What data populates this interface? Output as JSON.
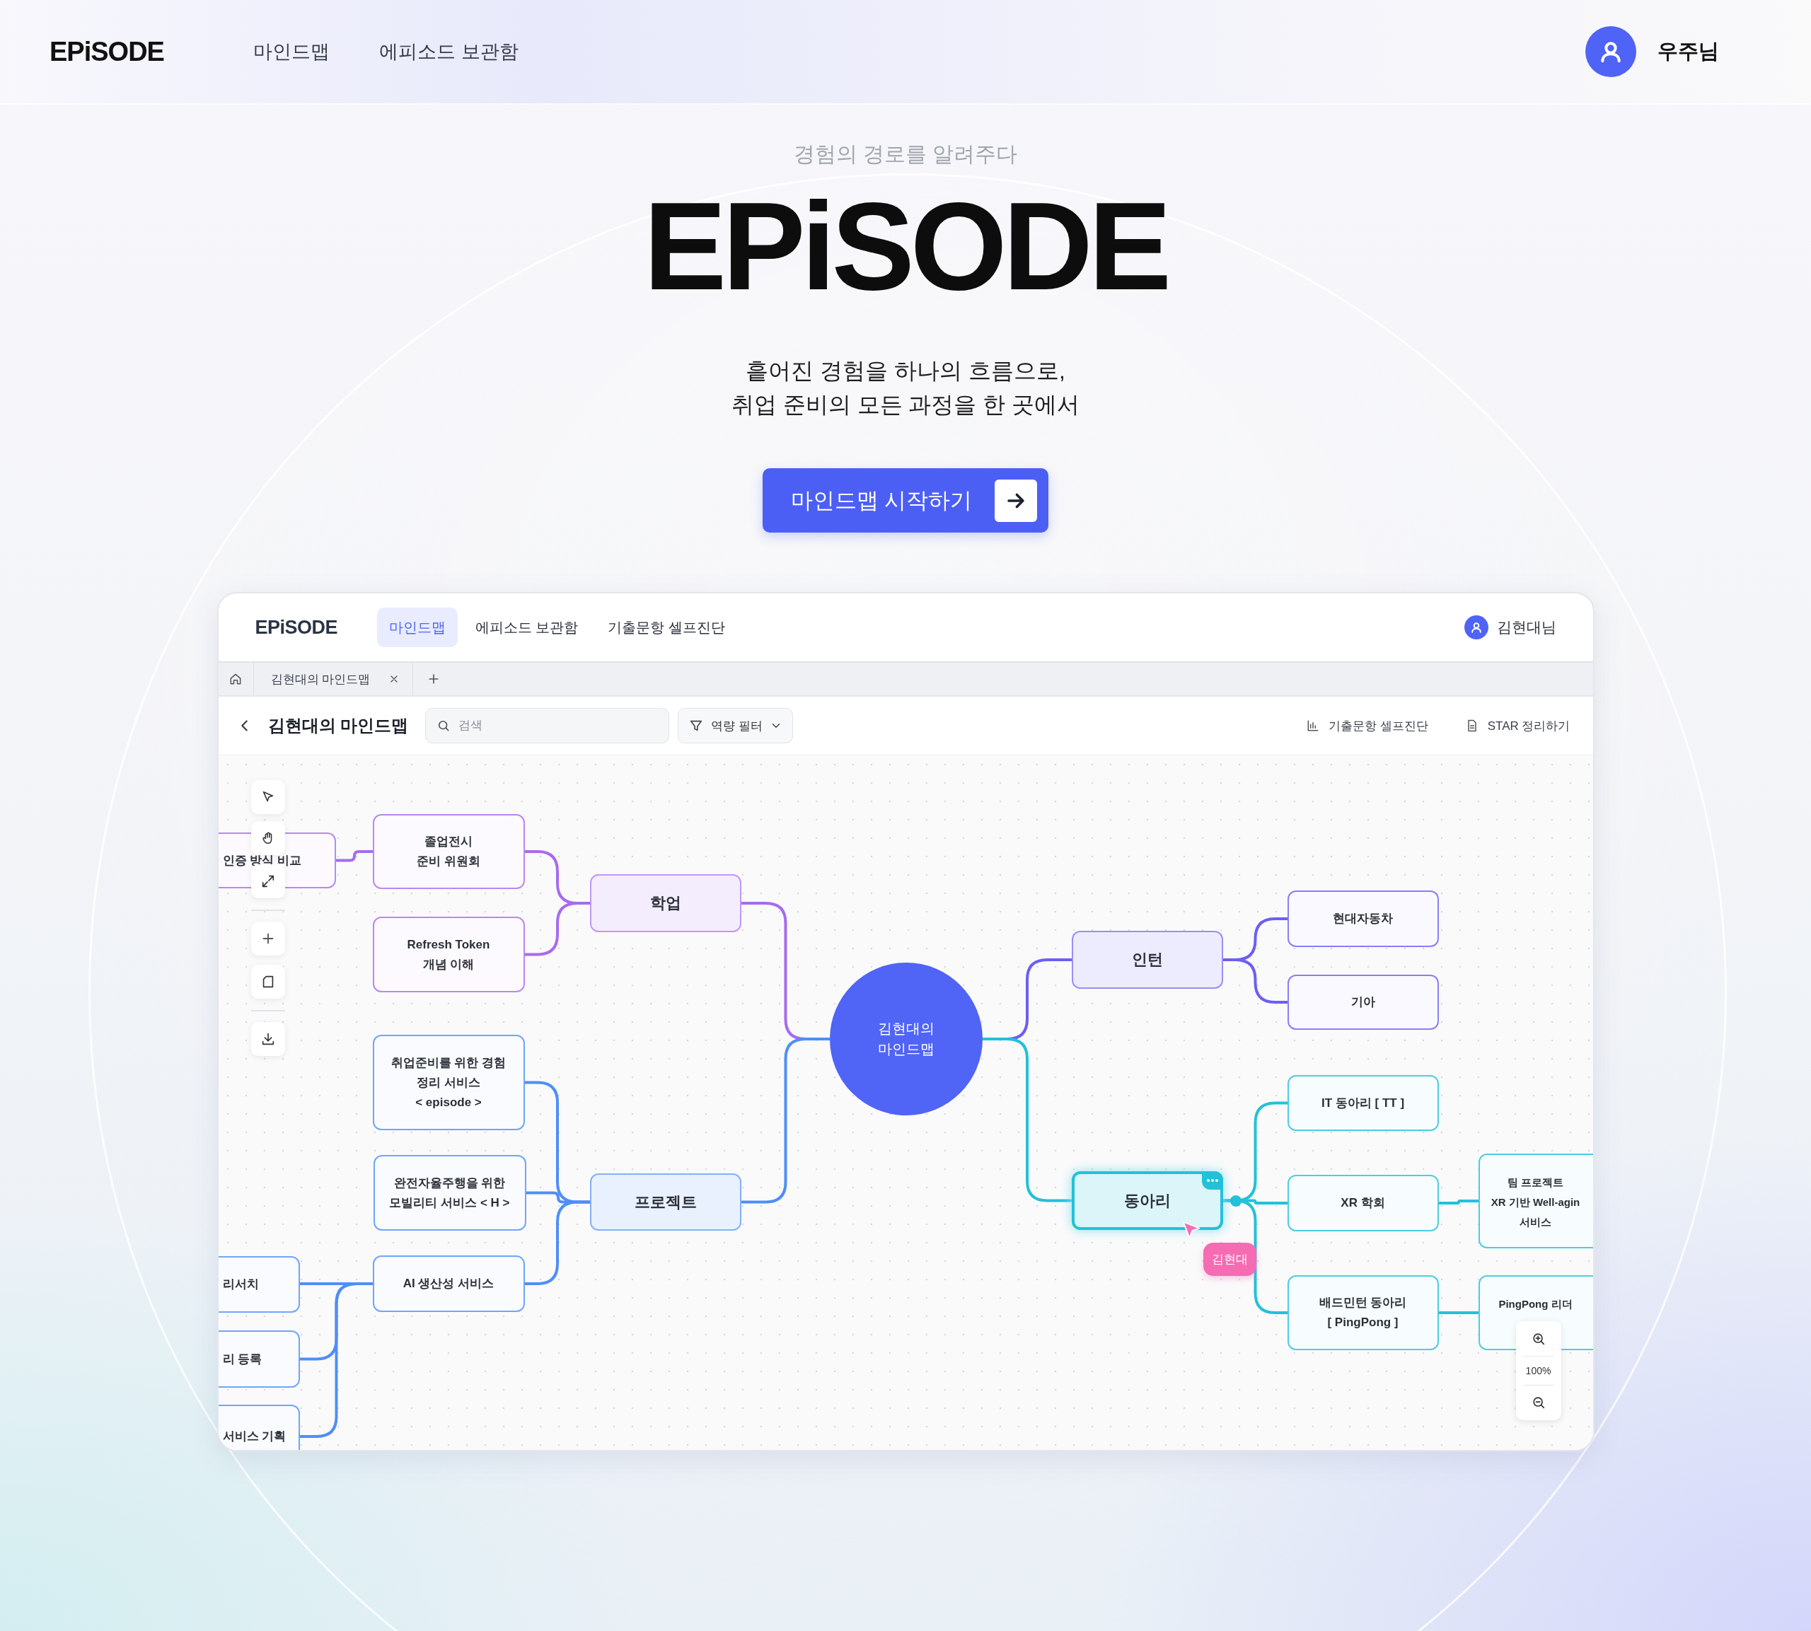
{
  "top_nav": {
    "logo": "EPiSODE",
    "links": [
      "마인드맵",
      "에피소드 보관함"
    ],
    "user": "우주님"
  },
  "hero": {
    "subtitle": "경험의 경로를 알려주다",
    "title": "EPiSODE",
    "tagline": [
      "흩어진 경험을 하나의 흐름으로,",
      "취업 준비의 모든 과정을 한 곳에서"
    ],
    "cta": "마인드맵 시작하기"
  },
  "app": {
    "header": {
      "logo": "EPiSODE",
      "tabs": [
        {
          "label": "마인드맵",
          "selected": true
        },
        {
          "label": "에피소드 보관함",
          "selected": false
        },
        {
          "label": "기출문항 셀프진단",
          "selected": false
        }
      ],
      "user": "김현대님"
    },
    "doc_tabs": [
      "김현대의 마인드맵"
    ],
    "toolbar": {
      "title": "김현대의 마인드맵",
      "search": {
        "placeholder": "검색"
      },
      "filter": "역량 필터",
      "actions": [
        {
          "kind": "chart",
          "label": "기출문항 셀프진단"
        },
        {
          "kind": "document",
          "label": "STAR 정리하기"
        }
      ]
    },
    "mindmap": {
      "root": "김현대의\n마인드맵",
      "branches": [
        {
          "label": "학업",
          "color": "#a66bf0",
          "selected": false,
          "children": [
            {
              "label": "졸업전시\n준비 위원회",
              "selected": false,
              "children": [
                {
                  "label": "인증 방식 비교",
                  "selected": false
                }
              ]
            },
            {
              "label": "Refresh Token\n개념 이해",
              "selected": false
            }
          ]
        },
        {
          "label": "프로젝트",
          "color": "#4f8ef7",
          "selected": false,
          "children": [
            {
              "label": "취업준비를 위한 경험\n정리 서비스\n< episode >",
              "selected": false
            },
            {
              "label": "완전자율주행을 위한\n모빌리티 서비스 < H >",
              "selected": false
            },
            {
              "label": "AI 생산성 서비스",
              "selected": false,
              "children": [
                {
                  "label": "리서치",
                  "selected": false
                },
                {
                  "label": "리 등록",
                  "selected": false
                },
                {
                  "label": "서비스 기획",
                  "selected": false
                }
              ]
            }
          ]
        },
        {
          "label": "인턴",
          "color": "#6d5ef3",
          "selected": false,
          "children": [
            {
              "label": "현대자동차",
              "selected": false
            },
            {
              "label": "기아",
              "selected": false
            }
          ]
        },
        {
          "label": "동아리",
          "color": "#22c1d9",
          "selected": true,
          "children": [
            {
              "label": "IT 동아리 [ TT ]",
              "selected": false
            },
            {
              "label": "XR 학회",
              "selected": false,
              "children": [
                {
                  "label": "팀 프로젝트\nXR 기반 Well-agin\n서비스",
                  "selected": false
                }
              ]
            },
            {
              "label": "배드민턴 동아리\n[ PingPong ]",
              "selected": false,
              "children": [
                {
                  "label": "PingPong 리더",
                  "selected": false
                }
              ]
            }
          ]
        }
      ]
    },
    "cursor": {
      "name": "김현대"
    },
    "zoom": {
      "reading": "100%"
    }
  }
}
